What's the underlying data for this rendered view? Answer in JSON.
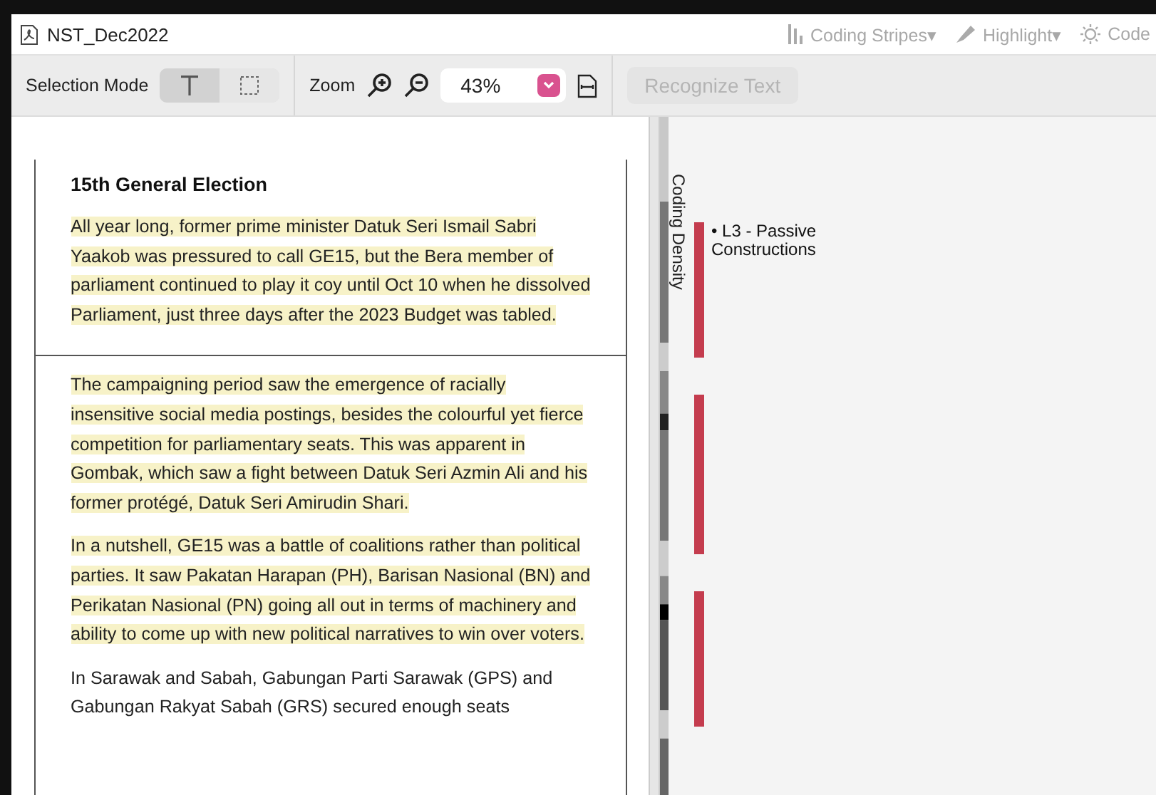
{
  "window": {
    "title": "NST_Dec2022"
  },
  "title_tools": [
    {
      "kind": "stripes",
      "label": "Coding Stripes▾",
      "disabled": true
    },
    {
      "kind": "highlight",
      "label": "Highlight▾",
      "disabled": true
    },
    {
      "kind": "code",
      "label": "Code",
      "disabled": true
    }
  ],
  "toolbar": {
    "selection_label": "Selection Mode",
    "modes": [
      {
        "kind": "text",
        "selected": true
      },
      {
        "kind": "region",
        "selected": false
      }
    ],
    "zoom_label": "Zoom",
    "zoom_value": "43%",
    "recognize": {
      "label": "Recognize Text",
      "disabled": true
    }
  },
  "document": {
    "pages": [
      {
        "heading": "15th General Election",
        "paragraphs": [
          {
            "text": "All year long, former prime minister Datuk Seri Ismail Sabri Yaakob was pressured to call GE15, but the Bera member of parliament continued to play it coy until Oct 10 when he dissolved Parliament, just three days after the 2023 Budget was tabled.",
            "highlighted": true
          }
        ]
      },
      {
        "paragraphs": [
          {
            "text": "The campaigning period saw the emergence of racially insensitive social media postings, besides the colourful yet fierce competition for parliamentary seats. This was apparent in Gombak, which saw a fight between Datuk Seri Azmin Ali and his former protégé, Datuk Seri Amirudin Shari.",
            "highlighted": true
          },
          {
            "text": "In a nutshell, GE15 was a battle of coalitions rather than political parties. It saw Pakatan Harapan (PH), Barisan Nasional (BN) and Perikatan Nasional (PN) going all out in terms of machinery and ability to come up with new political narratives to win over voters.",
            "highlighted": true
          },
          {
            "text": "In Sarawak and Sabah, Gabungan Parti Sarawak (GPS) and Gabungan Rakyat Sabah (GRS) secured enough seats",
            "highlighted": false
          }
        ]
      }
    ]
  },
  "coding_density": {
    "label": "Coding Density"
  },
  "coding_stripes": [
    {
      "label": "• L3 - Passive Constructions",
      "color": "#c43c4e"
    },
    {
      "color": "#c43c4e"
    },
    {
      "color": "#c43c4e"
    }
  ]
}
